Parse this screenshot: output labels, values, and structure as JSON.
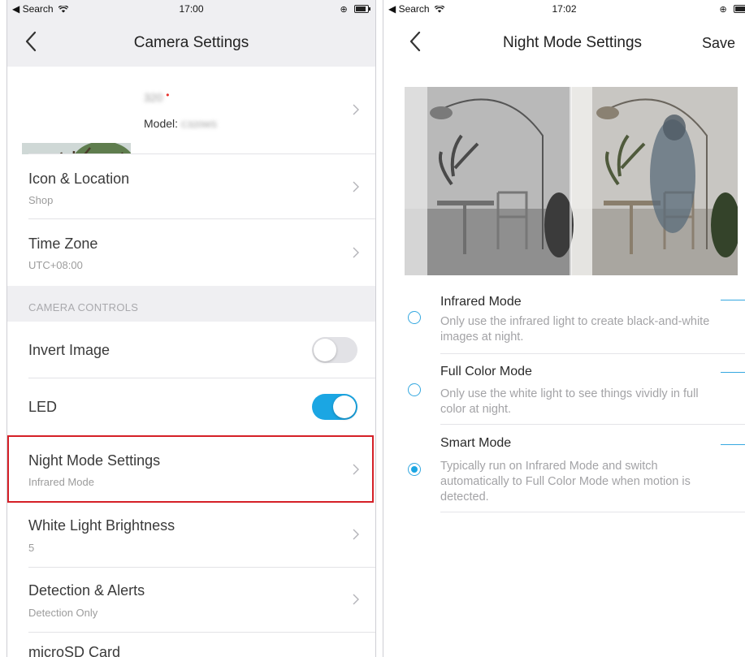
{
  "left": {
    "status": {
      "back_label": "◀ Search",
      "time": "17:00"
    },
    "nav": {
      "title": "Camera Settings"
    },
    "device": {
      "name": "320",
      "model_label": "Model:",
      "model_value": "C320WS"
    },
    "rows": [
      {
        "title": "Icon & Location",
        "subtitle": "Shop"
      },
      {
        "title": "Time Zone",
        "subtitle": "UTC+08:00"
      }
    ],
    "section_header": "CAMERA CONTROLS",
    "toggles": [
      {
        "title": "Invert Image",
        "state": "off"
      },
      {
        "title": "LED",
        "state": "on"
      }
    ],
    "nav_rows": [
      {
        "title": "Night Mode Settings",
        "subtitle": "Infrared Mode"
      },
      {
        "title": "White Light Brightness",
        "subtitle": "5"
      },
      {
        "title": "Detection & Alerts",
        "subtitle": "Detection Only"
      },
      {
        "title": "microSD Card",
        "subtitle": ""
      }
    ]
  },
  "right": {
    "status": {
      "back_label": "◀ Search",
      "time": "17:02"
    },
    "nav": {
      "title": "Night Mode Settings",
      "save": "Save"
    },
    "modes": [
      {
        "title": "Infrared Mode",
        "desc": "Only use the infrared light to create black-and-white images at night.",
        "selected": false
      },
      {
        "title": "Full Color Mode",
        "desc": "Only use the white light to see things vividly in full color at night.",
        "selected": false
      },
      {
        "title": "Smart Mode",
        "desc": "Typically run on Infrared Mode and switch automatically to Full Color Mode when motion is detected.",
        "selected": true
      }
    ]
  },
  "colors": {
    "accent": "#1ba6e3",
    "highlight": "#d52027",
    "toggle_off": "#e2e2e6"
  },
  "icons": [
    "back-chevron-icon",
    "chevron-right-icon",
    "wifi-icon",
    "battery-icon",
    "radio-icon"
  ]
}
